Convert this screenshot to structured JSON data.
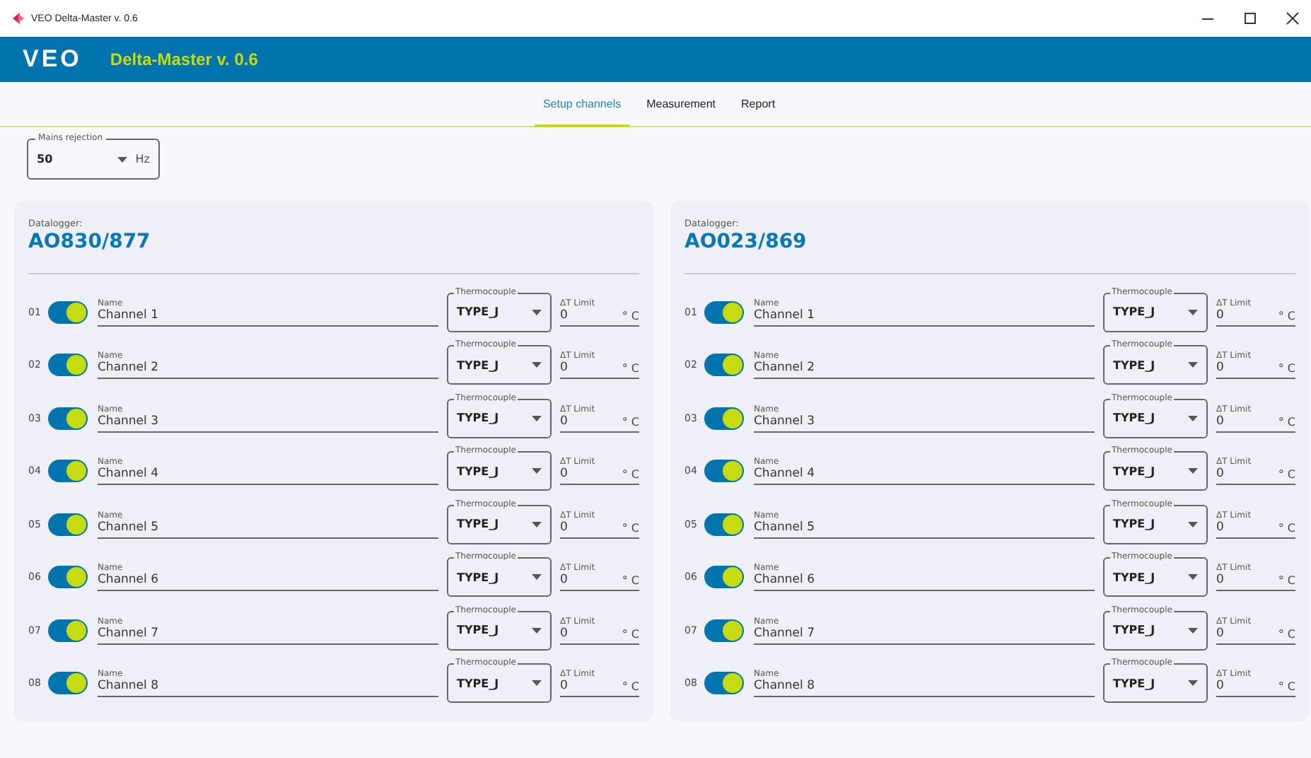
{
  "window": {
    "title": "VEO Delta-Master v. 0.6"
  },
  "header": {
    "logo": "VEO",
    "title": "Delta-Master v. 0.6"
  },
  "tabs": [
    {
      "label": "Setup channels",
      "selected": true
    },
    {
      "label": "Measurement",
      "selected": false
    },
    {
      "label": "Report",
      "selected": false
    }
  ],
  "mains_rejection": {
    "label": "Mains rejection",
    "value": "50",
    "unit": "Hz"
  },
  "dataloggers": [
    {
      "label": "Datalogger:",
      "id": "AO830/877",
      "channels": [
        {
          "number": "01",
          "on": true,
          "name_label": "Name",
          "name": "Channel 1",
          "thermo_label": "Thermocouple",
          "type": "TYPE_J",
          "limit_label": "ΔT Limit",
          "limit": "0",
          "unit": "° C"
        },
        {
          "number": "02",
          "on": true,
          "name_label": "Name",
          "name": "Channel 2",
          "thermo_label": "Thermocouple",
          "type": "TYPE_J",
          "limit_label": "ΔT Limit",
          "limit": "0",
          "unit": "° C"
        },
        {
          "number": "03",
          "on": true,
          "name_label": "Name",
          "name": "Channel 3",
          "thermo_label": "Thermocouple",
          "type": "TYPE_J",
          "limit_label": "ΔT Limit",
          "limit": "0",
          "unit": "° C"
        },
        {
          "number": "04",
          "on": true,
          "name_label": "Name",
          "name": "Channel 4",
          "thermo_label": "Thermocouple",
          "type": "TYPE_J",
          "limit_label": "ΔT Limit",
          "limit": "0",
          "unit": "° C"
        },
        {
          "number": "05",
          "on": true,
          "name_label": "Name",
          "name": "Channel 5",
          "thermo_label": "Thermocouple",
          "type": "TYPE_J",
          "limit_label": "ΔT Limit",
          "limit": "0",
          "unit": "° C"
        },
        {
          "number": "06",
          "on": true,
          "name_label": "Name",
          "name": "Channel 6",
          "thermo_label": "Thermocouple",
          "type": "TYPE_J",
          "limit_label": "ΔT Limit",
          "limit": "0",
          "unit": "° C"
        },
        {
          "number": "07",
          "on": true,
          "name_label": "Name",
          "name": "Channel 7",
          "thermo_label": "Thermocouple",
          "type": "TYPE_J",
          "limit_label": "ΔT Limit",
          "limit": "0",
          "unit": "° C"
        },
        {
          "number": "08",
          "on": true,
          "name_label": "Name",
          "name": "Channel 8",
          "thermo_label": "Thermocouple",
          "type": "TYPE_J",
          "limit_label": "ΔT Limit",
          "limit": "0",
          "unit": "° C"
        }
      ]
    },
    {
      "label": "Datalogger:",
      "id": "AO023/869",
      "channels": [
        {
          "number": "01",
          "on": true,
          "name_label": "Name",
          "name": "Channel 1",
          "thermo_label": "Thermocouple",
          "type": "TYPE_J",
          "limit_label": "ΔT Limit",
          "limit": "0",
          "unit": "° C"
        },
        {
          "number": "02",
          "on": true,
          "name_label": "Name",
          "name": "Channel 2",
          "thermo_label": "Thermocouple",
          "type": "TYPE_J",
          "limit_label": "ΔT Limit",
          "limit": "0",
          "unit": "° C"
        },
        {
          "number": "03",
          "on": true,
          "name_label": "Name",
          "name": "Channel 3",
          "thermo_label": "Thermocouple",
          "type": "TYPE_J",
          "limit_label": "ΔT Limit",
          "limit": "0",
          "unit": "° C"
        },
        {
          "number": "04",
          "on": true,
          "name_label": "Name",
          "name": "Channel 4",
          "thermo_label": "Thermocouple",
          "type": "TYPE_J",
          "limit_label": "ΔT Limit",
          "limit": "0",
          "unit": "° C"
        },
        {
          "number": "05",
          "on": true,
          "name_label": "Name",
          "name": "Channel 5",
          "thermo_label": "Thermocouple",
          "type": "TYPE_J",
          "limit_label": "ΔT Limit",
          "limit": "0",
          "unit": "° C"
        },
        {
          "number": "06",
          "on": true,
          "name_label": "Name",
          "name": "Channel 6",
          "thermo_label": "Thermocouple",
          "type": "TYPE_J",
          "limit_label": "ΔT Limit",
          "limit": "0",
          "unit": "° C"
        },
        {
          "number": "07",
          "on": true,
          "name_label": "Name",
          "name": "Channel 7",
          "thermo_label": "Thermocouple",
          "type": "TYPE_J",
          "limit_label": "ΔT Limit",
          "limit": "0",
          "unit": "° C"
        },
        {
          "number": "08",
          "on": true,
          "name_label": "Name",
          "name": "Channel 8",
          "thermo_label": "Thermocouple",
          "type": "TYPE_J",
          "limit_label": "ΔT Limit",
          "limit": "0",
          "unit": "° C"
        }
      ]
    }
  ]
}
